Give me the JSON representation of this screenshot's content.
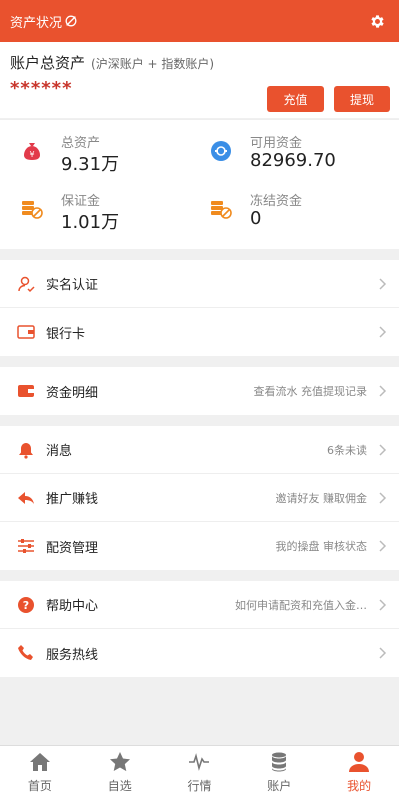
{
  "header": {
    "title": "资产状况",
    "visibility_icon": "eye-off-icon",
    "settings_icon": "gear-icon",
    "bg_color": "#e9522e"
  },
  "account": {
    "title": "账户总资产",
    "subtitle": "(沪深账户 + 指数账户)",
    "masked_amount": "******",
    "recharge_label": "充值",
    "withdraw_label": "提现"
  },
  "stats": {
    "total": {
      "label": "总资产",
      "value": "9.31万",
      "icon": "money-bag-icon"
    },
    "available": {
      "label": "可用资金",
      "value": "82969.70",
      "icon": "coin-icon"
    },
    "margin": {
      "label": "保证金",
      "value": "1.01万",
      "icon": "coins-stack-icon"
    },
    "frozen": {
      "label": "冻结资金",
      "value": "0",
      "icon": "coins-frozen-icon"
    }
  },
  "menu": {
    "verify": {
      "label": "实名认证",
      "icon": "user-icon"
    },
    "bank": {
      "label": "银行卡",
      "icon": "card-icon"
    },
    "funds": {
      "label": "资金明细",
      "hint": "查看流水 充值提现记录",
      "icon": "wallet-icon"
    },
    "messages": {
      "label": "消息",
      "hint": "6条未读",
      "icon": "bell-icon"
    },
    "promote": {
      "label": "推广赚钱",
      "hint": "邀请好友 赚取佣金",
      "icon": "share-icon"
    },
    "allocation": {
      "label": "配资管理",
      "hint": "我的操盘 审核状态",
      "icon": "sliders-icon"
    },
    "help": {
      "label": "帮助中心",
      "hint": "如何申请配资和充值入金…",
      "icon": "question-icon"
    },
    "hotline": {
      "label": "服务热线",
      "icon": "phone-icon"
    }
  },
  "tabbar": {
    "home": "首页",
    "watchlist": "自选",
    "market": "行情",
    "account": "账户",
    "mine": "我的"
  },
  "colors": {
    "accent": "#e9522e",
    "icon_orange": "#f08b1f",
    "icon_blue": "#3a8ee6"
  }
}
